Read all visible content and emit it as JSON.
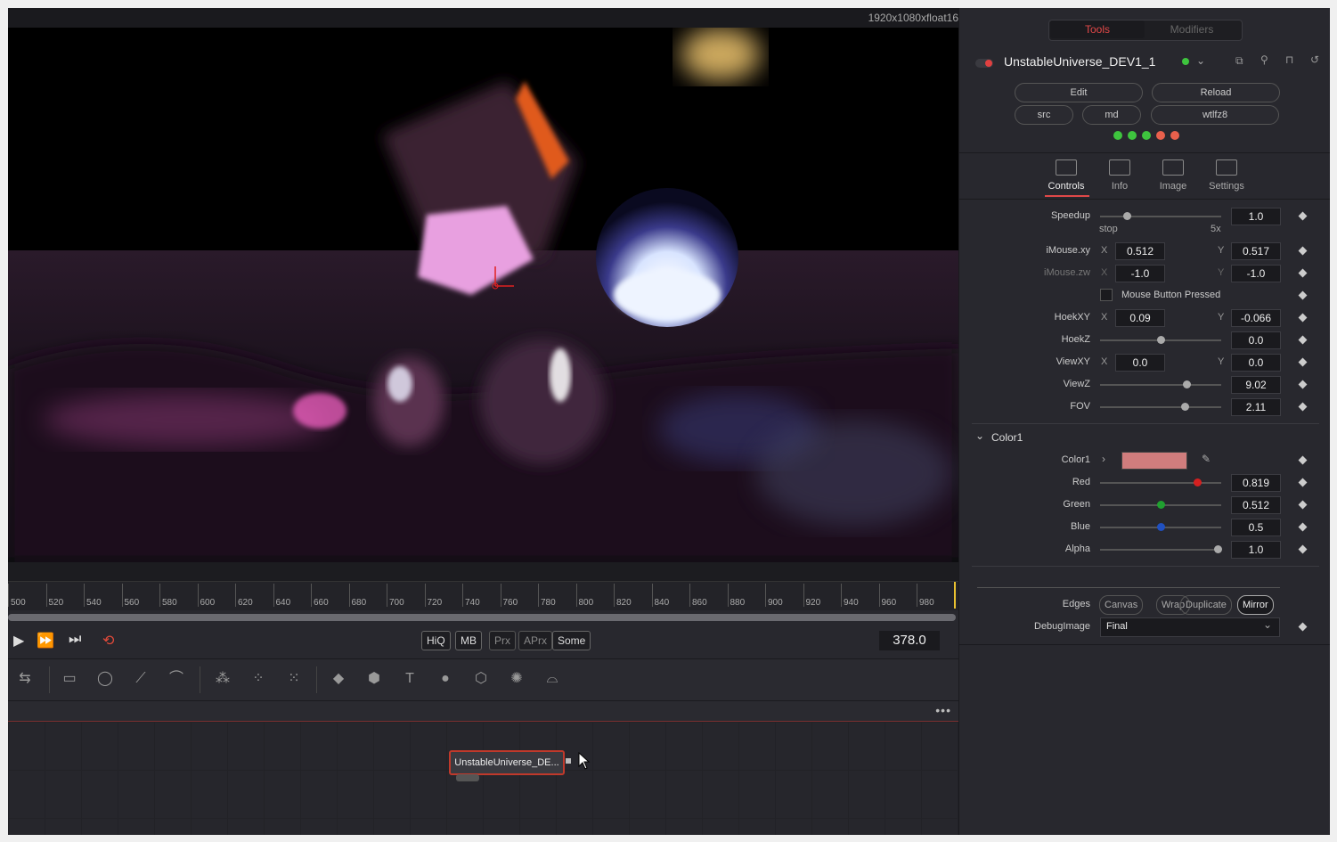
{
  "viewer": {
    "resolution": "1920x1080xfloat16"
  },
  "ruler": {
    "ticks": [
      "500",
      "520",
      "540",
      "560",
      "580",
      "600",
      "620",
      "640",
      "660",
      "680",
      "700",
      "720",
      "740",
      "760",
      "780",
      "800",
      "820",
      "840",
      "860",
      "880",
      "900",
      "920",
      "940",
      "960",
      "980"
    ]
  },
  "transport": {
    "quality_buttons": [
      "HiQ",
      "MB",
      "Prx",
      "APrx",
      "Some"
    ],
    "current_frame": "378.0"
  },
  "node": {
    "label": "UnstableUniverse_DE..."
  },
  "inspector": {
    "tabs_top": {
      "tools": "Tools",
      "modifiers": "Modifiers"
    },
    "tool_title": "UnstableUniverse_DEV1_1",
    "buttons": {
      "edit": "Edit",
      "reload": "Reload",
      "src": "src",
      "md": "md",
      "wtlfz8": "wtlfz8"
    },
    "status_dots": [
      "#3ec43e",
      "#3ec43e",
      "#3ec43e",
      "#e8604c",
      "#e8604c"
    ],
    "tabs": [
      {
        "label": "Controls"
      },
      {
        "label": "Info"
      },
      {
        "label": "Image"
      },
      {
        "label": "Settings"
      }
    ],
    "controls": {
      "speedup": {
        "label": "Speedup",
        "value": "1.0",
        "min_label": "stop",
        "max_label": "5x",
        "position": 0.22
      },
      "imouse_xy": {
        "label": "iMouse.xy",
        "x": "0.512",
        "y": "0.517"
      },
      "imouse_zw": {
        "label": "iMouse.zw",
        "x": "-1.0",
        "y": "-1.0"
      },
      "mouse_pressed": {
        "label": "Mouse Button Pressed"
      },
      "hoek_xy": {
        "label": "HoekXY",
        "x": "0.09",
        "y": "-0.066"
      },
      "hoek_z": {
        "label": "HoekZ",
        "value": "0.0",
        "position": 0.5
      },
      "view_xy": {
        "label": "ViewXY",
        "x": "0.0",
        "y": "0.0"
      },
      "view_z": {
        "label": "ViewZ",
        "value": "9.02",
        "position": 0.71
      },
      "fov": {
        "label": "FOV",
        "value": "2.11",
        "position": 0.7
      },
      "axis_x": "X",
      "axis_y": "Y"
    },
    "color_section": {
      "header": "Color1",
      "color_label": "Color1",
      "swatch": "#d07d7d",
      "red": {
        "label": "Red",
        "value": "0.819",
        "position": 0.8,
        "color": "#d42020"
      },
      "green": {
        "label": "Green",
        "value": "0.512",
        "position": 0.5,
        "color": "#20a030"
      },
      "blue": {
        "label": "Blue",
        "value": "0.5",
        "position": 0.5,
        "color": "#2050c0"
      },
      "alpha": {
        "label": "Alpha",
        "value": "1.0",
        "position": 0.97
      }
    },
    "edges": {
      "label": "Edges",
      "options": [
        "Canvas",
        "Wrap",
        "Duplicate",
        "Mirror"
      ],
      "selected": "Mirror"
    },
    "debug_image": {
      "label": "DebugImage",
      "value": "Final"
    }
  }
}
